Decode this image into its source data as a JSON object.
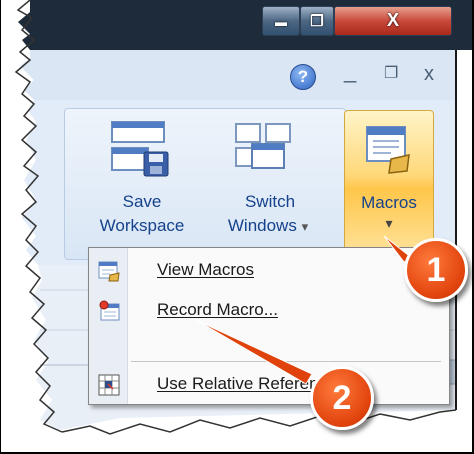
{
  "window_controls": {
    "minimize_glyph": "▬",
    "restore_glyph": "❐",
    "close_glyph": "X"
  },
  "app_controls": {
    "help_glyph": "?",
    "minimize_glyph": "_",
    "restore_glyph": "❐",
    "close_glyph": "x"
  },
  "ribbon": {
    "save_workspace": {
      "line1": "Save",
      "line2": "Workspace",
      "icon": "save-workspace-icon"
    },
    "switch_windows": {
      "line1": "Switch",
      "line2": "Windows",
      "dropdown_glyph": "▾",
      "icon": "switch-windows-icon"
    },
    "macros": {
      "label": "Macros",
      "dropdown_glyph": "▾",
      "icon": "macros-icon"
    }
  },
  "macro_menu": {
    "items": [
      {
        "label": "View Macros",
        "icon": "view-macros-icon"
      },
      {
        "label": "Record Macro...",
        "icon": "record-macro-icon"
      },
      {
        "label": "Use Relative References",
        "icon": "relative-references-icon"
      }
    ]
  },
  "callouts": [
    {
      "number": "1"
    },
    {
      "number": "2"
    }
  ],
  "colors": {
    "ribbon_bg": "#dbe7f6",
    "ribbon_highlight": "#fbd96a",
    "callout_orange": "#e0420c",
    "label_blue": "#15428b"
  }
}
